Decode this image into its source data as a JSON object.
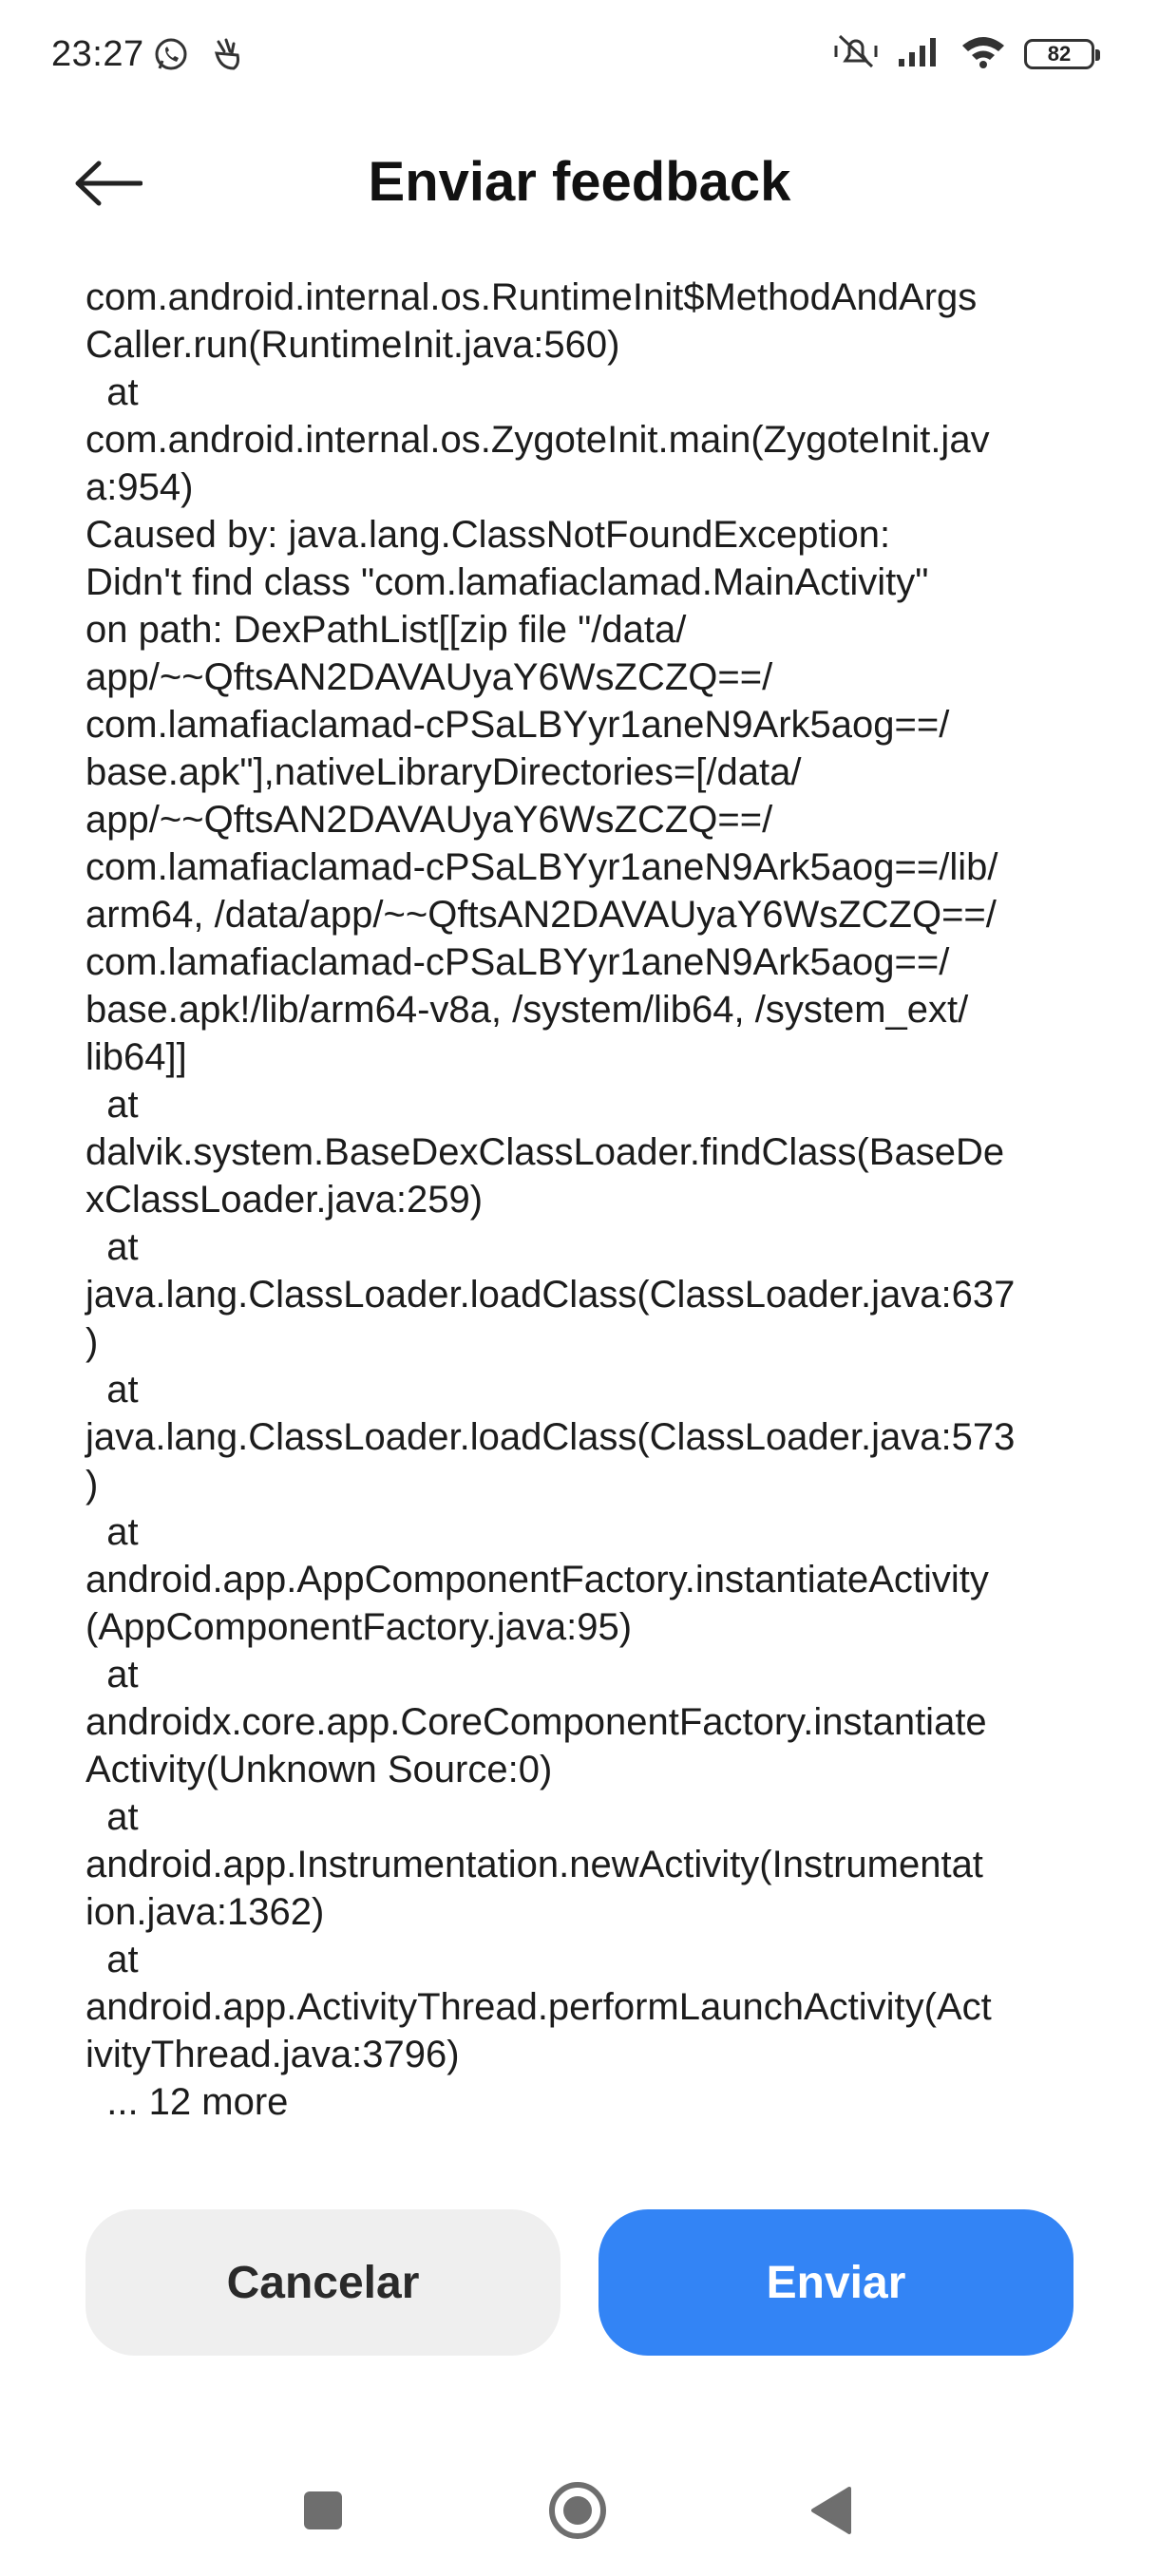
{
  "status_bar": {
    "time": "23:27",
    "battery": "82",
    "icons": [
      "whatsapp-icon",
      "notification-icon",
      "silent-vibrate-icon",
      "signal-icon",
      "wifi-icon",
      "battery-icon"
    ]
  },
  "header": {
    "title": "Enviar feedback",
    "back_icon": "arrow-left-icon"
  },
  "log": {
    "lines": [
      "com.android.internal.os.RuntimeInit$MethodAndArgs",
      "Caller.run(RuntimeInit.java:560)",
      "  at",
      "com.android.internal.os.ZygoteInit.main(ZygoteInit.jav",
      "a:954)",
      "Caused by: java.lang.ClassNotFoundException:",
      "Didn't find class \"com.lamafiaclamad.MainActivity\"",
      "on path: DexPathList[[zip file \"/data/",
      "app/~~QftsAN2DAVAUyaY6WsZCZQ==/",
      "com.lamafiaclamad-cPSaLBYyr1aneN9Ark5aog==/",
      "base.apk\"],nativeLibraryDirectories=[/data/",
      "app/~~QftsAN2DAVAUyaY6WsZCZQ==/",
      "com.lamafiaclamad-cPSaLBYyr1aneN9Ark5aog==/lib/",
      "arm64, /data/app/~~QftsAN2DAVAUyaY6WsZCZQ==/",
      "com.lamafiaclamad-cPSaLBYyr1aneN9Ark5aog==/",
      "base.apk!/lib/arm64-v8a, /system/lib64, /system_ext/",
      "lib64]]",
      "  at",
      "dalvik.system.BaseDexClassLoader.findClass(BaseDe",
      "xClassLoader.java:259)",
      "  at",
      "java.lang.ClassLoader.loadClass(ClassLoader.java:637",
      ")",
      "  at",
      "java.lang.ClassLoader.loadClass(ClassLoader.java:573",
      ")",
      "  at",
      "android.app.AppComponentFactory.instantiateActivity",
      "(AppComponentFactory.java:95)",
      "  at",
      "androidx.core.app.CoreComponentFactory.instantiate",
      "Activity(Unknown Source:0)",
      "  at",
      "android.app.Instrumentation.newActivity(Instrumentat",
      "ion.java:1362)",
      "  at",
      "android.app.ActivityThread.performLaunchActivity(Act",
      "ivityThread.java:3796)",
      "  ... 12 more"
    ]
  },
  "actions": {
    "cancel_label": "Cancelar",
    "send_label": "Enviar"
  },
  "nav_bar": {
    "icons": [
      "recents-square-icon",
      "home-circle-icon",
      "back-triangle-icon"
    ]
  },
  "colors": {
    "accent": "#3384f5",
    "cancel_bg": "#efefef",
    "text": "#1c1c1c"
  }
}
